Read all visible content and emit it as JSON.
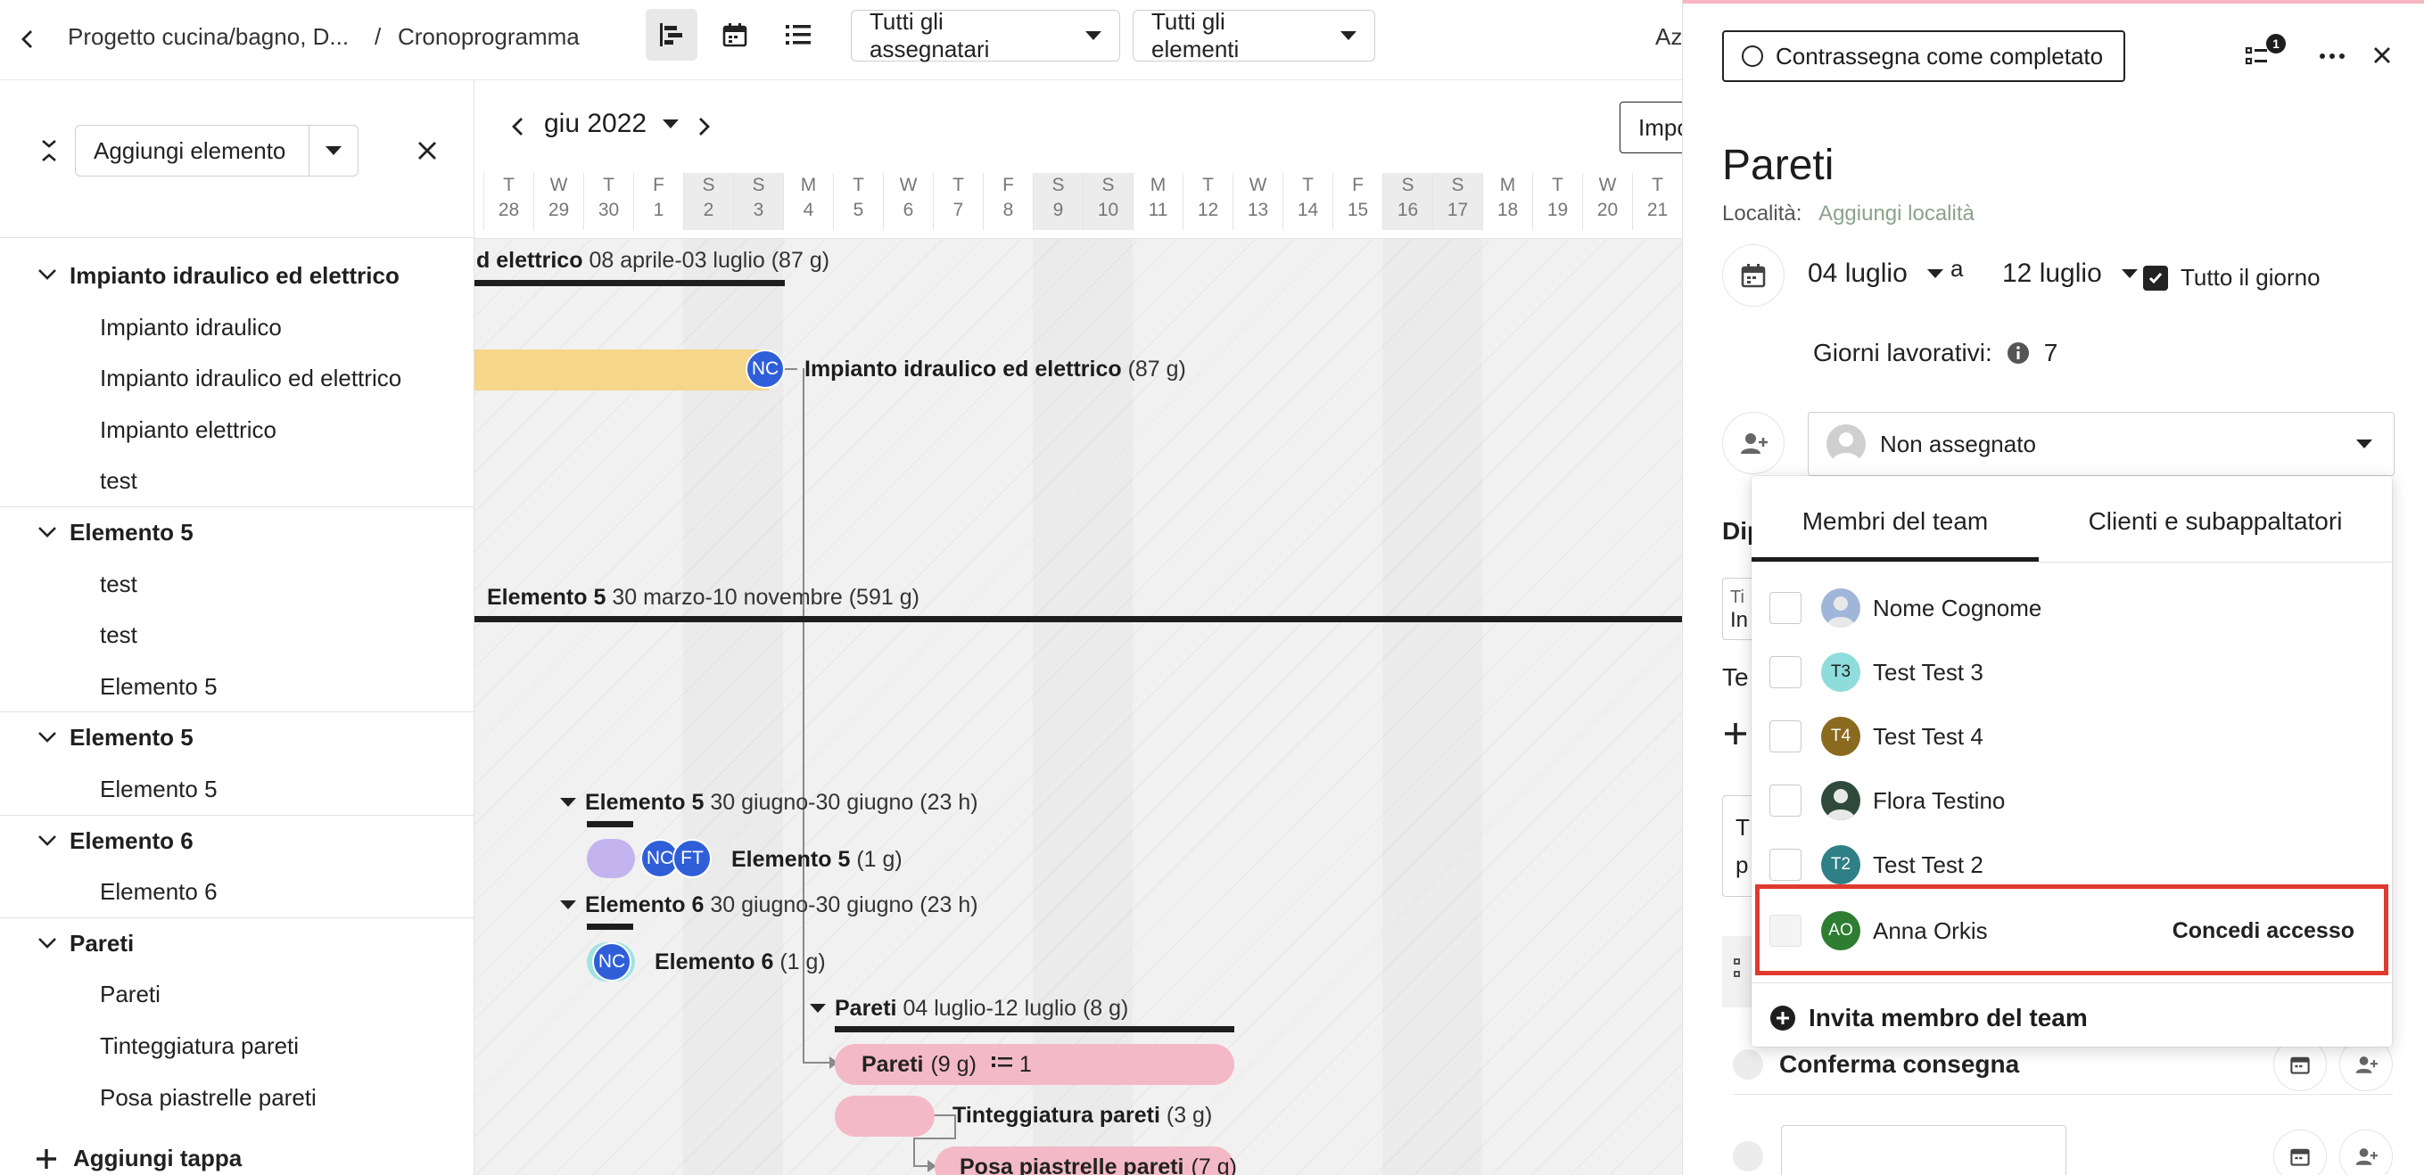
{
  "header": {
    "back_label": "<",
    "breadcrumb_project": "Progetto cucina/bagno, D...",
    "breadcrumb_sep": "/",
    "breadcrumb_page": "Cronoprogramma",
    "filter_assignees": "Tutti gli assegnatari",
    "filter_elements": "Tutti gli elementi",
    "cut_text": "Az"
  },
  "left_panel": {
    "add_element_label": "Aggiungi elemento",
    "add_stage_label": "Aggiungi tappa",
    "tree": [
      {
        "type": "group",
        "label": "Impianto idraulico ed elettrico"
      },
      {
        "type": "child",
        "label": "Impianto idraulico"
      },
      {
        "type": "child",
        "label": "Impianto idraulico ed elettrico"
      },
      {
        "type": "child",
        "label": "Impianto elettrico"
      },
      {
        "type": "child",
        "label": "test"
      },
      {
        "type": "group",
        "label": "Elemento 5"
      },
      {
        "type": "child",
        "label": "test"
      },
      {
        "type": "child",
        "label": "test"
      },
      {
        "type": "child",
        "label": "Elemento 5"
      },
      {
        "type": "group",
        "label": "Elemento 5"
      },
      {
        "type": "child",
        "label": "Elemento 5"
      },
      {
        "type": "group",
        "label": "Elemento 6"
      },
      {
        "type": "child",
        "label": "Elemento 6"
      },
      {
        "type": "group",
        "label": "Pareti"
      },
      {
        "type": "child",
        "label": "Pareti"
      },
      {
        "type": "child",
        "label": "Tinteggiatura pareti"
      },
      {
        "type": "child",
        "label": "Posa piastrelle pareti"
      }
    ]
  },
  "timeline": {
    "month_label": "giu 2022",
    "import_cut": "Impo",
    "days": [
      {
        "l": "T",
        "n": "28"
      },
      {
        "l": "W",
        "n": "29"
      },
      {
        "l": "T",
        "n": "30"
      },
      {
        "l": "F",
        "n": "1"
      },
      {
        "l": "S",
        "n": "2"
      },
      {
        "l": "S",
        "n": "3"
      },
      {
        "l": "M",
        "n": "4"
      },
      {
        "l": "T",
        "n": "5"
      },
      {
        "l": "W",
        "n": "6"
      },
      {
        "l": "T",
        "n": "7"
      },
      {
        "l": "F",
        "n": "8"
      },
      {
        "l": "S",
        "n": "9"
      },
      {
        "l": "S",
        "n": "10"
      },
      {
        "l": "M",
        "n": "11"
      },
      {
        "l": "T",
        "n": "12"
      },
      {
        "l": "W",
        "n": "13"
      },
      {
        "l": "T",
        "n": "14"
      },
      {
        "l": "F",
        "n": "15"
      },
      {
        "l": "S",
        "n": "16"
      },
      {
        "l": "S",
        "n": "17"
      },
      {
        "l": "M",
        "n": "18"
      },
      {
        "l": "T",
        "n": "19"
      },
      {
        "l": "W",
        "n": "20"
      },
      {
        "l": "T",
        "n": "21"
      }
    ],
    "rows": {
      "plumb_group_name": "d elettrico",
      "plumb_group_dates": "08 aprile-03 luglio (87 g)",
      "plumb_task_name": "Impianto idraulico ed elettrico",
      "plumb_task_dur": "(87 g)",
      "el5_group_name": "Elemento 5",
      "el5_group_dates": "30 marzo-10 novembre (591 g)",
      "el5b_group_name": "Elemento 5",
      "el5b_group_dates": "30 giugno-30 giugno (23 h)",
      "el5b_task_name": "Elemento 5",
      "el5b_task_dur": "(1 g)",
      "el6_group_name": "Elemento 6",
      "el6_group_dates": "30 giugno-30 giugno (23 h)",
      "el6_task_name": "Elemento 6",
      "el6_task_dur": "(1 g)",
      "walls_group_name": "Pareti",
      "walls_group_dates": "04 luglio-12 luglio (8 g)",
      "walls_task_name": "Pareti",
      "walls_task_dur": "(9 g)",
      "walls_task_count": "1",
      "paint_task_name": "Tinteggiatura pareti",
      "paint_task_dur": "(3 g)",
      "tile_task_name": "Posa piastrelle pareti",
      "tile_task_dur": "(7 g)"
    },
    "avatars": {
      "nc": "NC",
      "ft": "FT"
    }
  },
  "detail": {
    "mark_complete": "Contrassegna come completato",
    "checklist_badge": "1",
    "title": "Pareti",
    "location_label": "Località:",
    "location_add": "Aggiungi località",
    "start_date": "04 luglio",
    "to_label": "a",
    "end_date": "12 luglio",
    "all_day": "Tutto il giorno",
    "workdays_label": "Giorni lavorativi:",
    "workdays_value": "7",
    "assignee": "Non assegnato",
    "cut_dip": "Dip",
    "cut_ti": "Ti",
    "cut_in": "In",
    "cut_te": "Te",
    "cut_t": "T",
    "cut_p": "p",
    "confirm_delivery": "Conferma consegna"
  },
  "dropdown": {
    "tab_team": "Membri del team",
    "tab_clients": "Clienti e subappaltatori",
    "members": [
      {
        "name": "Nome Cognome",
        "initials": "",
        "color": "#9fb6d8"
      },
      {
        "name": "Test Test 3",
        "initials": "T3",
        "color": "#8fdcdc"
      },
      {
        "name": "Test Test 4",
        "initials": "T4",
        "color": "#8a6a1f"
      },
      {
        "name": "Flora Testino",
        "initials": "",
        "color": "#2f4a3a"
      },
      {
        "name": "Test Test 2",
        "initials": "T2",
        "color": "#2f7f86"
      }
    ],
    "invite_row": {
      "name": "Anna Orkis",
      "initials": "AO",
      "color": "#2e7d32",
      "action": "Concedi accesso"
    },
    "invite_team": "Invita membro del team",
    "highlight_color": "#e03a2f"
  }
}
